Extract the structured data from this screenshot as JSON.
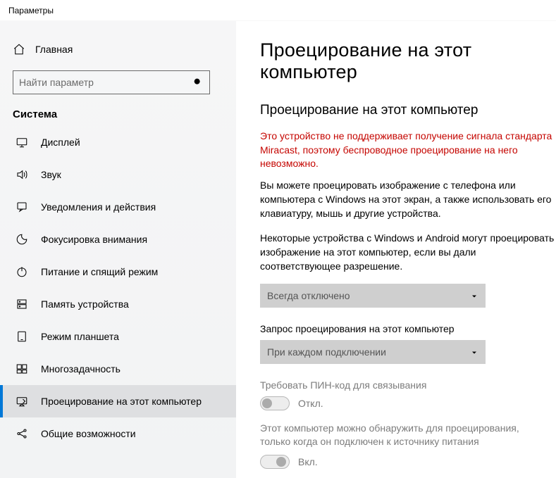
{
  "window": {
    "title": "Параметры"
  },
  "sidebar": {
    "home_label": "Главная",
    "search_placeholder": "Найти параметр",
    "section_label": "Система",
    "items": [
      {
        "label": "Дисплей",
        "icon": "display"
      },
      {
        "label": "Звук",
        "icon": "sound"
      },
      {
        "label": "Уведомления и действия",
        "icon": "notifications"
      },
      {
        "label": "Фокусировка внимания",
        "icon": "focus"
      },
      {
        "label": "Питание и спящий режим",
        "icon": "power"
      },
      {
        "label": "Память устройства",
        "icon": "storage"
      },
      {
        "label": "Режим планшета",
        "icon": "tablet"
      },
      {
        "label": "Многозадачность",
        "icon": "multitask"
      },
      {
        "label": "Проецирование на этот компьютер",
        "icon": "projecting",
        "selected": true
      },
      {
        "label": "Общие возможности",
        "icon": "shared"
      }
    ]
  },
  "main": {
    "page_title": "Проецирование на этот компьютер",
    "section_title": "Проецирование на этот компьютер",
    "error_text": "Это устройство не поддерживает получение сигнала стандарта Miracast, поэтому беспроводное проецирование на него невозможно.",
    "para1": "Вы можете проецировать изображение с телефона или компьютера с Windows на этот экран, а также использовать его клавиатуру, мышь и другие устройства.",
    "para2": "Некоторые устройства с Windows и Android могут проецировать изображение на этот компьютер, если вы дали соответствующее разрешение.",
    "dropdown1_value": "Всегда отключено",
    "label2": "Запрос проецирования на этот компьютер",
    "dropdown2_value": "При каждом подключении",
    "label_pin": "Требовать ПИН-код для связывания",
    "toggle_pin_text": "Откл.",
    "label_power": "Этот компьютер можно обнаружить для проецирования, только когда он подключен к источнику питания",
    "toggle_power_text": "Вкл."
  }
}
